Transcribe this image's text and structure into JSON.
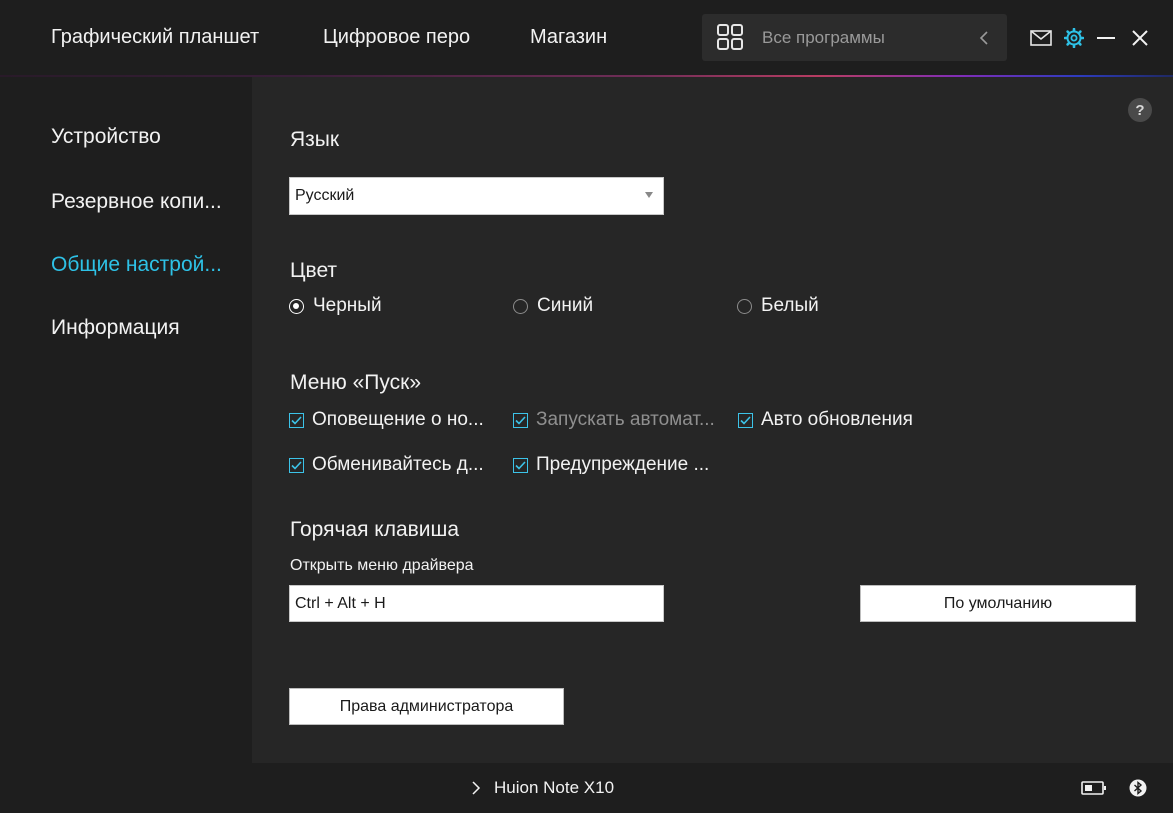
{
  "topbar": {
    "nav": [
      "Графический планшет",
      "Цифровое перо",
      "Магазин"
    ],
    "apps_label": "Все программы",
    "icons": [
      "apps-grid-icon",
      "chevron-left-icon",
      "mail-icon",
      "gear-icon",
      "minimize-icon",
      "close-icon"
    ],
    "accent_color": "#2ec1e6"
  },
  "sidebar": {
    "items": [
      {
        "label": "Устройство",
        "active": false
      },
      {
        "label": "Резервное копи...",
        "active": false
      },
      {
        "label": "Общие настрой...",
        "active": true
      },
      {
        "label": "Информация",
        "active": false
      }
    ]
  },
  "main": {
    "help_label": "?",
    "language": {
      "title": "Язык",
      "selected": "Русский"
    },
    "color": {
      "title": "Цвет",
      "options": [
        {
          "label": "Черный",
          "checked": true
        },
        {
          "label": "Синий",
          "checked": false
        },
        {
          "label": "Белый",
          "checked": false
        }
      ]
    },
    "startup": {
      "title": "Меню «Пуск»",
      "options": [
        {
          "label": "Оповещение о но...",
          "checked": true,
          "enabled": true
        },
        {
          "label": "Запускать автомат...",
          "checked": true,
          "enabled": false
        },
        {
          "label": "Авто обновления",
          "checked": true,
          "enabled": true
        },
        {
          "label": "Обменивайтесь д...",
          "checked": true,
          "enabled": true
        },
        {
          "label": "Предупреждение ...",
          "checked": true,
          "enabled": true
        }
      ]
    },
    "hotkey": {
      "title": "Горячая клавиша",
      "subtitle": "Открыть меню драйвера",
      "value": "Ctrl + Alt + H",
      "default_button": "По умолчанию"
    },
    "admin_button": "Права администратора"
  },
  "bottombar": {
    "device_name": "Huion Note X10",
    "icons": [
      "chevron-right-icon",
      "battery-icon",
      "bluetooth-icon"
    ]
  }
}
